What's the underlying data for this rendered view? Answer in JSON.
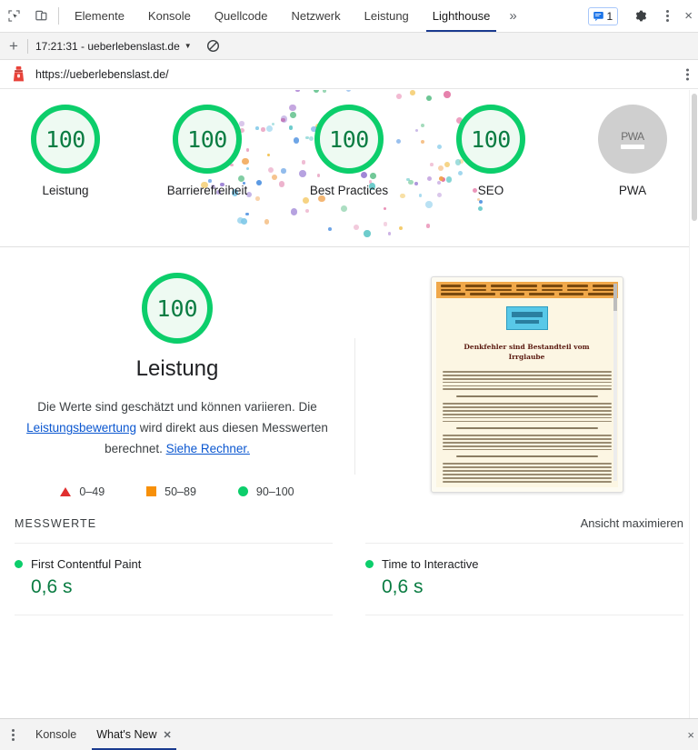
{
  "devtools": {
    "icons": [
      "inspect-element-icon",
      "device-toolbar-icon"
    ],
    "tabs": [
      {
        "label": "Elemente",
        "active": false
      },
      {
        "label": "Konsole",
        "active": false
      },
      {
        "label": "Quellcode",
        "active": false
      },
      {
        "label": "Netzwerk",
        "active": false
      },
      {
        "label": "Leistung",
        "active": false
      },
      {
        "label": "Lighthouse",
        "active": true
      }
    ],
    "more_tabs": "»",
    "message_count": "1",
    "close_label": "×"
  },
  "lighthouse_toolbar": {
    "add_label": "+",
    "run_selector": "17:21:31 - ueberlebenslast.de",
    "caret": "▼"
  },
  "url_bar": {
    "url": "https://ueberlebenslast.de/"
  },
  "scores": [
    {
      "label": "Leistung",
      "value": "100"
    },
    {
      "label": "Barrierefreiheit",
      "value": "100"
    },
    {
      "label": "Best Practices",
      "value": "100"
    },
    {
      "label": "SEO",
      "value": "100"
    },
    {
      "label": "PWA",
      "value": "PWA",
      "null_score": true
    }
  ],
  "performance": {
    "score": "100",
    "title": "Leistung",
    "desc_part1": "Die Werte sind geschätzt und können variieren. Die ",
    "desc_link1": "Leistungsbewertung",
    "desc_part2": " wird direkt aus diesen Messwerten berechnet. ",
    "desc_link2": "Siehe Rechner.",
    "legend": [
      {
        "marker": "triangle",
        "range": "0–49",
        "color": "#e02f2f"
      },
      {
        "marker": "square",
        "range": "50–89",
        "color": "#f79009"
      },
      {
        "marker": "circle",
        "range": "90–100",
        "color": "#0cce6b"
      }
    ]
  },
  "thumbnail": {
    "heading_line1": "Denkfehler sind Bestandteil vom",
    "heading_line2": "Irrglaube"
  },
  "metrics": {
    "section_title": "MESSWERTE",
    "expand_label": "Ansicht maximieren",
    "items": [
      {
        "name": "First Contentful Paint",
        "value": "0,6 s",
        "status": "pass"
      },
      {
        "name": "Time to Interactive",
        "value": "0,6 s",
        "status": "pass"
      }
    ]
  },
  "drawer": {
    "tabs": [
      {
        "label": "Konsole",
        "active": false,
        "closable": false
      },
      {
        "label": "What's New",
        "active": true,
        "closable": true
      }
    ],
    "close_glyph": "✕",
    "drawer_close": "×"
  },
  "colors": {
    "pass_green": "#0cce6b",
    "pass_green_dark": "#0a7c42",
    "average_orange": "#f79009",
    "fail_red": "#e02f2f",
    "link_blue": "#0b57d0",
    "tab_underline": "#1a3a8f",
    "null_gray": "#cfcfcf"
  }
}
